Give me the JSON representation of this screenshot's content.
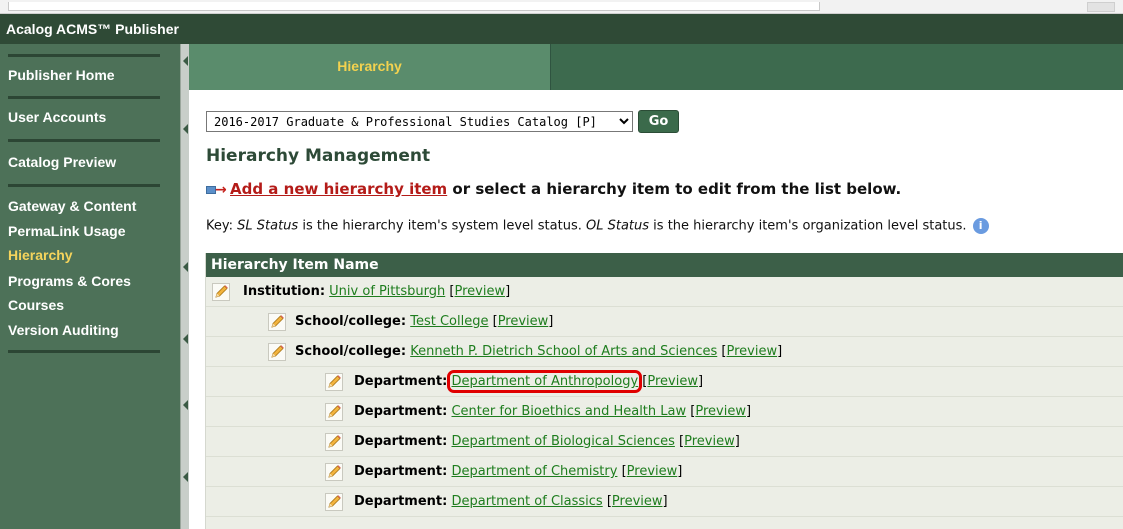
{
  "app": {
    "title": "Acalog ACMS™ Publisher"
  },
  "sidebar": {
    "items": [
      {
        "label": "Publisher Home"
      },
      {
        "label": "User Accounts"
      },
      {
        "label": "Catalog Preview"
      },
      {
        "label": "Gateway & Content"
      },
      {
        "label": "PermaLink Usage"
      },
      {
        "label": "Hierarchy",
        "active": true
      },
      {
        "label": "Programs & Cores"
      },
      {
        "label": "Courses"
      },
      {
        "label": "Version Auditing"
      }
    ]
  },
  "tabs": {
    "active_label": "Hierarchy"
  },
  "catalog_select": {
    "selected": "2016-2017 Graduate & Professional Studies Catalog [P]",
    "go_label": "Go"
  },
  "page": {
    "title": "Hierarchy Management",
    "add_link": "Add a new hierarchy item",
    "add_suffix": " or select a hierarchy item to edit from the list below.",
    "key": {
      "prefix": "Key: ",
      "sl": "SL Status",
      "mid": " is the hierarchy item's system level status. ",
      "ol": "OL Status",
      "suffix": " is the hierarchy item's organization level status.",
      "info_glyph": "i"
    }
  },
  "table": {
    "header": "Hierarchy Item Name",
    "preview_label": "Preview",
    "rows": [
      {
        "type": "Institution:",
        "name": "Univ of Pittsburgh",
        "level": 0
      },
      {
        "type": "School/college:",
        "name": "Test College",
        "level": 1
      },
      {
        "type": "School/college:",
        "name": "Kenneth P. Dietrich School of Arts and Sciences",
        "level": 1
      },
      {
        "type": "Department:",
        "name": "Department of Anthropology",
        "level": 2,
        "highlighted": true
      },
      {
        "type": "Department:",
        "name": "Center for Bioethics and Health Law",
        "level": 2
      },
      {
        "type": "Department:",
        "name": "Department of Biological Sciences",
        "level": 2
      },
      {
        "type": "Department:",
        "name": "Department of Chemistry",
        "level": 2
      },
      {
        "type": "Department:",
        "name": "Department of Classics",
        "level": 2
      }
    ]
  },
  "colors": {
    "brand_dark": "#2f4a36",
    "sidebar": "#4d7158",
    "link": "#1e7d1e",
    "active": "#f5d45c",
    "highlight": "#e00000"
  }
}
